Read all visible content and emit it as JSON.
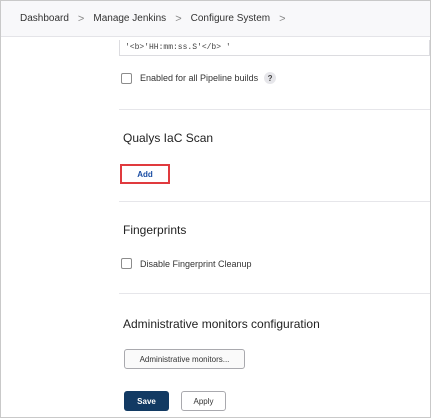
{
  "breadcrumb": {
    "items": [
      "Dashboard",
      "Manage Jenkins",
      "Configure System"
    ],
    "separator": ">"
  },
  "timestamp_field": {
    "value": "'<b>'HH:mm:ss.S'</b> '"
  },
  "pipeline_option": {
    "label": "Enabled for all Pipeline builds",
    "help": "?"
  },
  "qualys_section": {
    "title": "Qualys IaC Scan",
    "add_label": "Add"
  },
  "fingerprints_section": {
    "title": "Fingerprints",
    "checkbox_label": "Disable Fingerprint Cleanup"
  },
  "admin_monitors_section": {
    "title": "Administrative monitors configuration",
    "button_label": "Administrative monitors..."
  },
  "footer": {
    "save_label": "Save",
    "apply_label": "Apply"
  },
  "colors": {
    "highlight": "#e03a3e",
    "primary": "#123a63",
    "link": "#1a4da3"
  }
}
